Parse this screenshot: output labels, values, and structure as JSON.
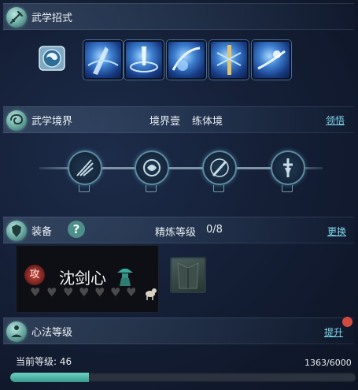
{
  "skills_section": {
    "title": "武学招式"
  },
  "realm_section": {
    "title": "武学境界",
    "realm_label": "境界壹",
    "realm_name": "练体境",
    "link": "领悟"
  },
  "equip_section": {
    "title": "装备",
    "help_glyph": "?",
    "refine_label": "精炼等级",
    "refine_value": "0/8",
    "link": "更换"
  },
  "weapon": {
    "badge": "攻",
    "name": "沈剑心",
    "hearts_total": 7
  },
  "mind_section": {
    "title": "心法等级",
    "link": "提升",
    "level_label": "当前等级: 46",
    "exp": "1363/6000",
    "progress": 0.227
  },
  "colors": {
    "link": "#7fd6ea",
    "progress_fill": "#4fb3a6",
    "badge_red": "#d24a3f"
  }
}
